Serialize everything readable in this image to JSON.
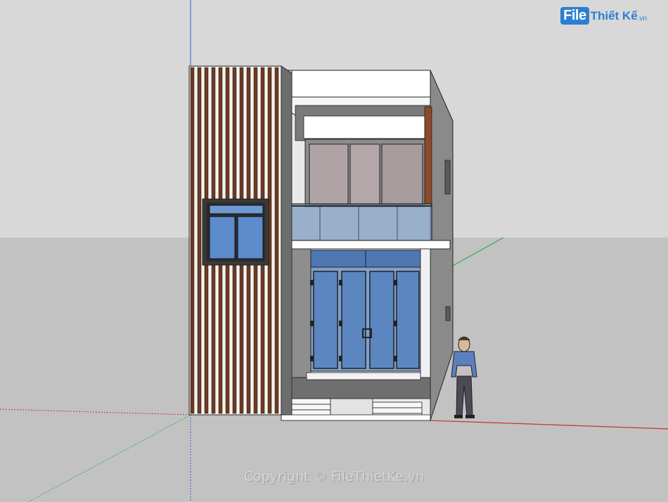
{
  "scene": {
    "sky_color": "#d8d8d8",
    "ground_color": "#c2c2c2",
    "axis_colors": {
      "red": "#c0392b",
      "green": "#2fae4a",
      "blue": "#3a5fd8"
    },
    "model": "two-storey townhouse facade with vertical timber louvers, glass balcony and folding glass doors",
    "figure": "scale-figure"
  },
  "logo": {
    "part1": "File",
    "part2": "Thiết Kế",
    "tld": ".vn"
  },
  "watermark": {
    "text": "Copyright © FileThietKe.vn"
  }
}
